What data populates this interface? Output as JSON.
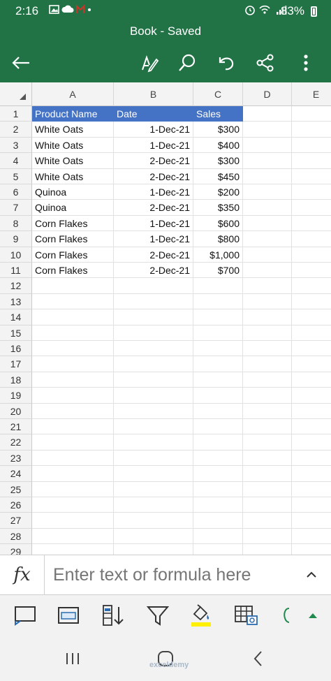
{
  "status": {
    "time": "2:16",
    "battery": "83%"
  },
  "title": "Book - Saved",
  "columns": [
    "A",
    "B",
    "C",
    "D",
    "E"
  ],
  "rows": [
    "1",
    "2",
    "3",
    "4",
    "5",
    "6",
    "7",
    "8",
    "9",
    "10",
    "11",
    "12",
    "13",
    "14",
    "15",
    "16",
    "17",
    "18",
    "19",
    "20",
    "21",
    "22",
    "23",
    "24",
    "25",
    "26",
    "27",
    "28",
    "29"
  ],
  "table": {
    "headers": [
      "Product Name",
      "Date",
      "Sales"
    ],
    "data": [
      [
        "White Oats",
        "1-Dec-21",
        "$300"
      ],
      [
        "White Oats",
        "1-Dec-21",
        "$400"
      ],
      [
        "White Oats",
        "2-Dec-21",
        "$300"
      ],
      [
        "White Oats",
        "2-Dec-21",
        "$450"
      ],
      [
        "Quinoa",
        "1-Dec-21",
        "$200"
      ],
      [
        "Quinoa",
        "2-Dec-21",
        "$350"
      ],
      [
        "Corn Flakes",
        "1-Dec-21",
        "$600"
      ],
      [
        "Corn Flakes",
        "1-Dec-21",
        "$800"
      ],
      [
        "Corn Flakes",
        "2-Dec-21",
        "$1,000"
      ],
      [
        "Corn Flakes",
        "2-Dec-21",
        "$700"
      ]
    ]
  },
  "formula": {
    "fx_label": "fx",
    "placeholder": "Enter text or formula here"
  },
  "watermark": "exceldemy",
  "colors": {
    "brand": "#217346",
    "header_fill": "#4472c4",
    "highlight": "#ffef00"
  }
}
